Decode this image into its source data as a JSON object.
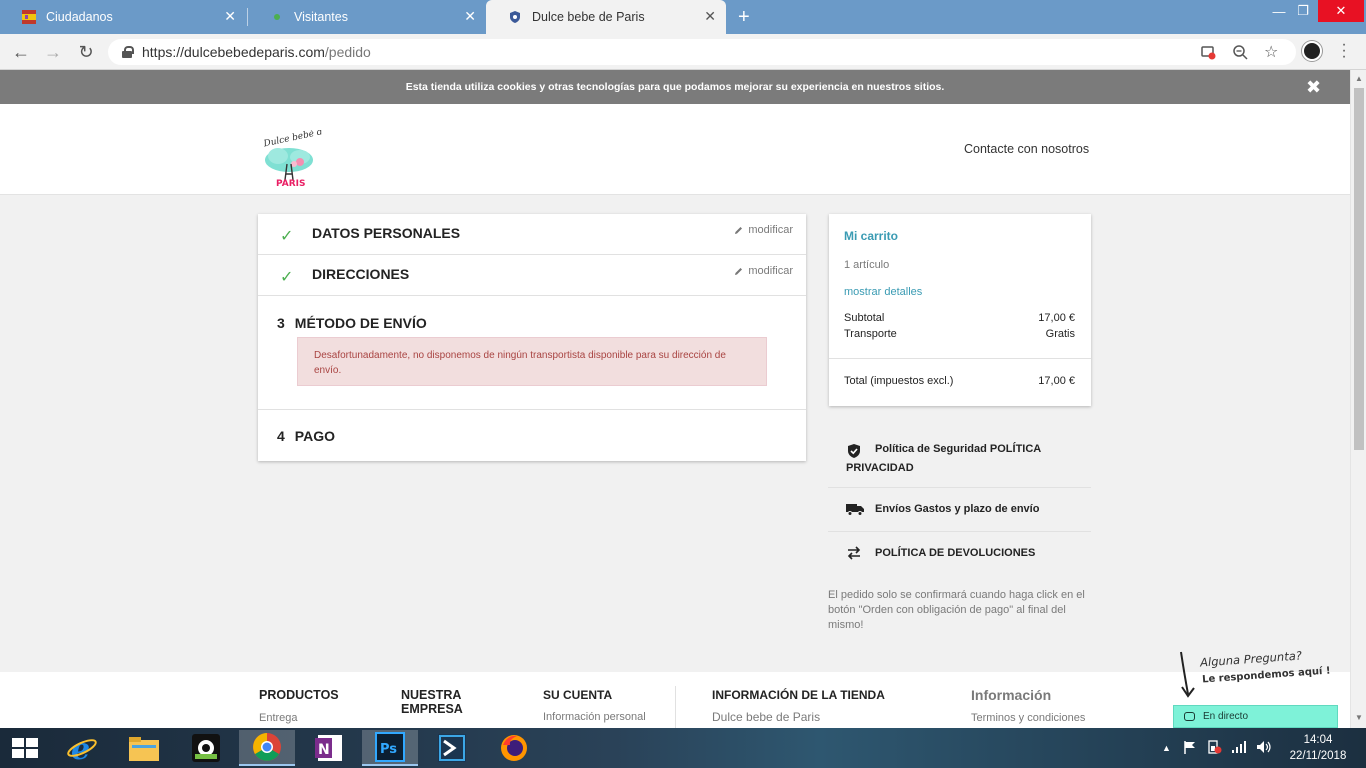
{
  "browser": {
    "tabs": [
      {
        "label": "Ciudadanos",
        "favicon_color": "#f1c40f"
      },
      {
        "label": "Visitantes",
        "favicon_color": "#4caf50"
      },
      {
        "label": "Dulce bebe de Paris",
        "favicon_color": "#3b5998"
      }
    ],
    "address": {
      "domain": "https://dulcebebedeparis.com",
      "path": "/pedido"
    }
  },
  "cookie_bar": {
    "text": "Esta tienda utiliza cookies y otras tecnologías para que podamos mejorar su experiencia en nuestros sitios."
  },
  "header": {
    "contact_label": "Contacte con nosotros",
    "logo_text_top": "Dulce bebé de",
    "logo_text_bottom": "PARIS"
  },
  "checkout": {
    "steps": [
      {
        "title": "DATOS PERSONALES",
        "modify": "modificar"
      },
      {
        "title": "DIRECCIONES",
        "modify": "modificar"
      },
      {
        "number": "3",
        "title": "MÉTODO DE ENVÍO",
        "alert": "Desafortunadamente, no disponemos de ningún transportista disponible para su dirección de envío."
      },
      {
        "number": "4",
        "title": "PAGO"
      }
    ]
  },
  "cart": {
    "title": "Mi carrito",
    "count": "1 artículo",
    "details_link": "mostrar detalles",
    "subtotal_label": "Subtotal",
    "subtotal_value": "17,00 €",
    "shipping_label": "Transporte",
    "shipping_value": "Gratis",
    "total_label": "Total (impuestos excl.)",
    "total_value": "17,00 €"
  },
  "reassurance": [
    {
      "text": "Política de Seguridad POLÍTICA PRIVACIDAD",
      "icon": "shield-check-icon"
    },
    {
      "text": "Envíos Gastos y plazo de envío",
      "icon": "truck-icon"
    },
    {
      "text": "POLÍTICA DE DEVOLUCIONES",
      "icon": "swap-arrows-icon"
    }
  ],
  "confirm_note": "El pedido solo se confirmará cuando haga click en el botón \"Orden con obligación de pago\" al final del mismo!",
  "footer": {
    "products": {
      "title": "PRODUCTOS",
      "first": "Entrega"
    },
    "company": {
      "title": "NUESTRA EMPRESA"
    },
    "account": {
      "title": "SU CUENTA",
      "first": "Información personal"
    },
    "store_info": {
      "title": "INFORMACIÓN DE LA TIENDA",
      "first": "Dulce bebe de Paris"
    },
    "information": {
      "title": "Información",
      "first": "Terminos y condiciones"
    }
  },
  "chat": {
    "question": "Alguna Pregunta?",
    "answer": "Le respondemos aquí !",
    "button": "En directo"
  },
  "taskbar": {
    "time": "14:04",
    "date": "22/11/2018"
  },
  "colors": {
    "accent": "#3a9bb3",
    "chrome_blue": "#6b9ac8",
    "alert_bg": "#f2dede",
    "alert_text": "#a94442",
    "chat": "#7ef2d8"
  }
}
